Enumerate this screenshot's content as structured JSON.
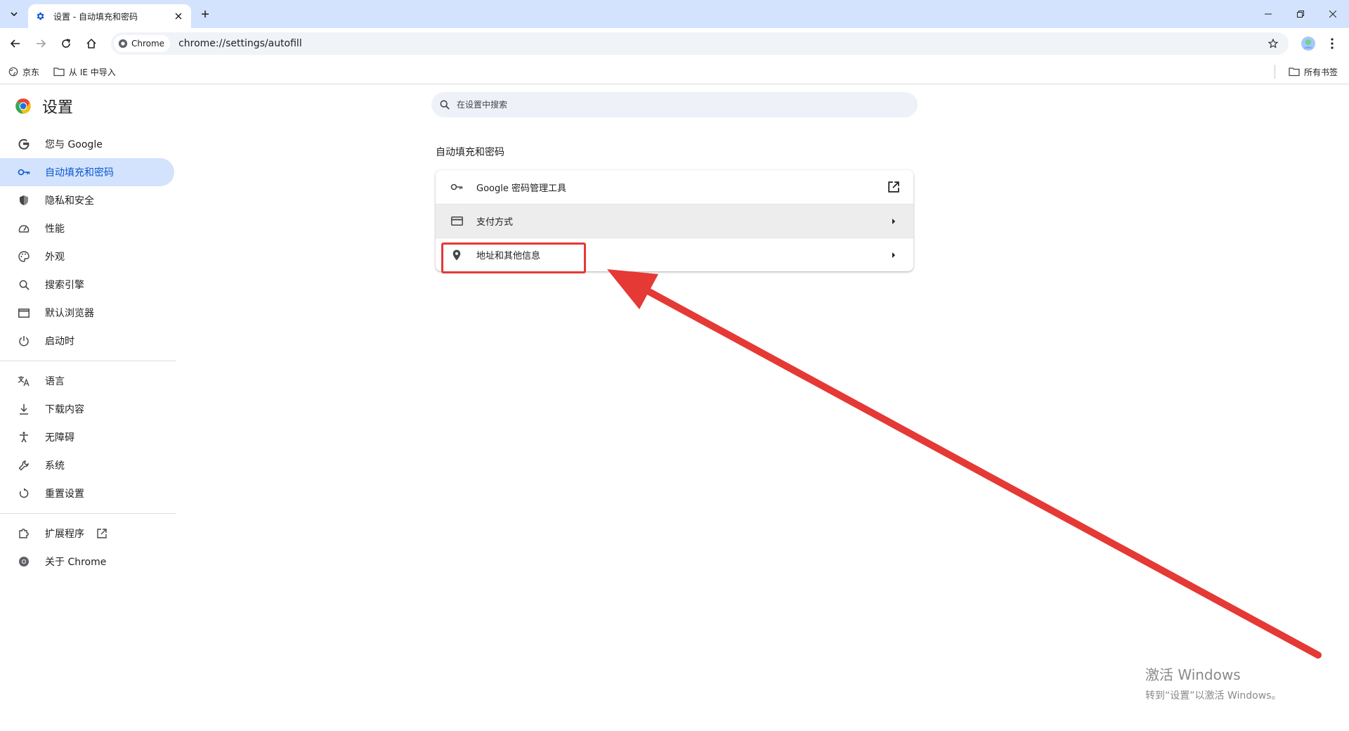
{
  "browser": {
    "tab": {
      "title": "设置 - 自动填充和密码",
      "favicon": "gear-icon"
    },
    "omnibox": {
      "site_chip": "Chrome",
      "url": "chrome://settings/autofill"
    },
    "bookmarks": [
      {
        "label": "京东",
        "icon": "globe-icon"
      },
      {
        "label": "从 IE 中导入",
        "icon": "folder-icon"
      }
    ],
    "all_bookmarks_label": "所有书签"
  },
  "settings": {
    "title": "设置",
    "search_placeholder": "在设置中搜索",
    "nav": [
      {
        "label": "您与 Google",
        "icon": "google-icon",
        "active": false
      },
      {
        "label": "自动填充和密码",
        "icon": "key-icon",
        "active": true
      },
      {
        "label": "隐私和安全",
        "icon": "shield-icon",
        "active": false
      },
      {
        "label": "性能",
        "icon": "speedometer-icon",
        "active": false
      },
      {
        "label": "外观",
        "icon": "palette-icon",
        "active": false
      },
      {
        "label": "搜索引擎",
        "icon": "search-icon",
        "active": false
      },
      {
        "label": "默认浏览器",
        "icon": "browser-window-icon",
        "active": false
      },
      {
        "label": "启动时",
        "icon": "power-icon",
        "active": false
      },
      {
        "label": "语言",
        "icon": "translate-icon",
        "active": false
      },
      {
        "label": "下载内容",
        "icon": "download-icon",
        "active": false
      },
      {
        "label": "无障碍",
        "icon": "accessibility-icon",
        "active": false
      },
      {
        "label": "系统",
        "icon": "wrench-icon",
        "active": false
      },
      {
        "label": "重置设置",
        "icon": "reset-icon",
        "active": false
      },
      {
        "label": "扩展程序",
        "icon": "puzzle-icon",
        "active": false
      },
      {
        "label": "关于 Chrome",
        "icon": "chrome-icon",
        "active": false
      }
    ],
    "section_title": "自动填充和密码",
    "rows": [
      {
        "label": "Google 密码管理工具",
        "icon": "key-icon",
        "action": "open-in-new-icon"
      },
      {
        "label": "支付方式",
        "icon": "credit-card-icon",
        "action": "arrow-right-icon"
      },
      {
        "label": "地址和其他信息",
        "icon": "location-pin-icon",
        "action": "arrow-right-icon"
      }
    ]
  },
  "annotation": {
    "color": "#e53935"
  },
  "watermark": {
    "title": "激活 Windows",
    "subtitle": "转到“设置”以激活 Windows。"
  },
  "colors": {
    "accent": "#0b57d0",
    "active_nav_bg": "#d3e3fd",
    "tabstrip_bg": "#d3e3fd",
    "annotation_red": "#e53935"
  }
}
